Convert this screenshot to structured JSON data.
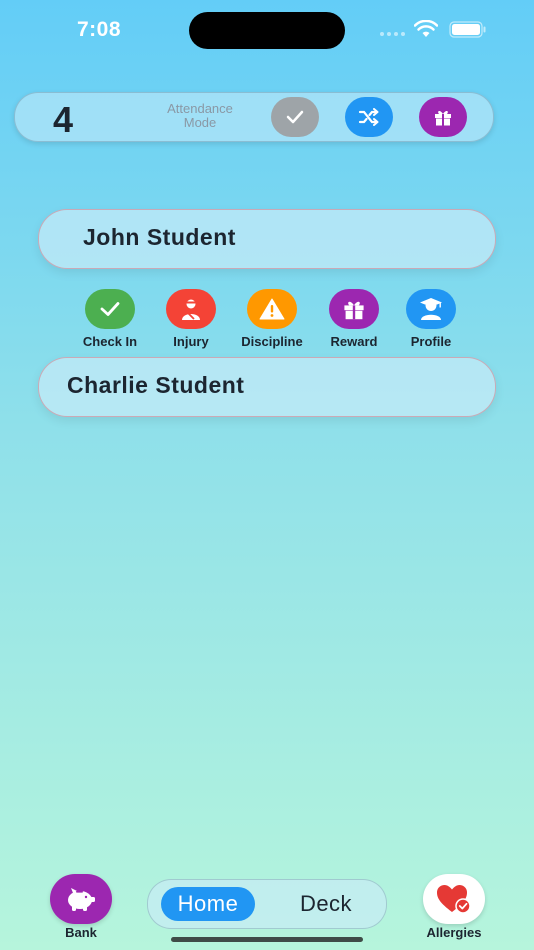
{
  "status_bar": {
    "time": "7:08"
  },
  "attendance": {
    "count": "4",
    "mode_label": "Attendance\nMode"
  },
  "students": [
    {
      "name": "John Student"
    },
    {
      "name": "Charlie Student"
    }
  ],
  "actions": [
    {
      "label": "Check In",
      "icon": "check-icon",
      "color": "#4caf50"
    },
    {
      "label": "Injury",
      "icon": "injury-icon",
      "color": "#f44336"
    },
    {
      "label": "Discipline",
      "icon": "warning-icon",
      "color": "#ff9800"
    },
    {
      "label": "Reward",
      "icon": "gift-icon",
      "color": "#9c27b0"
    },
    {
      "label": "Profile",
      "icon": "graduate-icon",
      "color": "#2196f3"
    }
  ],
  "bottom": {
    "bank_label": "Bank",
    "allergies_label": "Allergies",
    "tabs": [
      {
        "label": "Home",
        "selected": true
      },
      {
        "label": "Deck",
        "selected": false
      }
    ]
  },
  "colors": {
    "accent_blue": "#2196f3",
    "purple": "#9c27b0",
    "grey": "#9ea4a8",
    "text": "#1c2530"
  }
}
